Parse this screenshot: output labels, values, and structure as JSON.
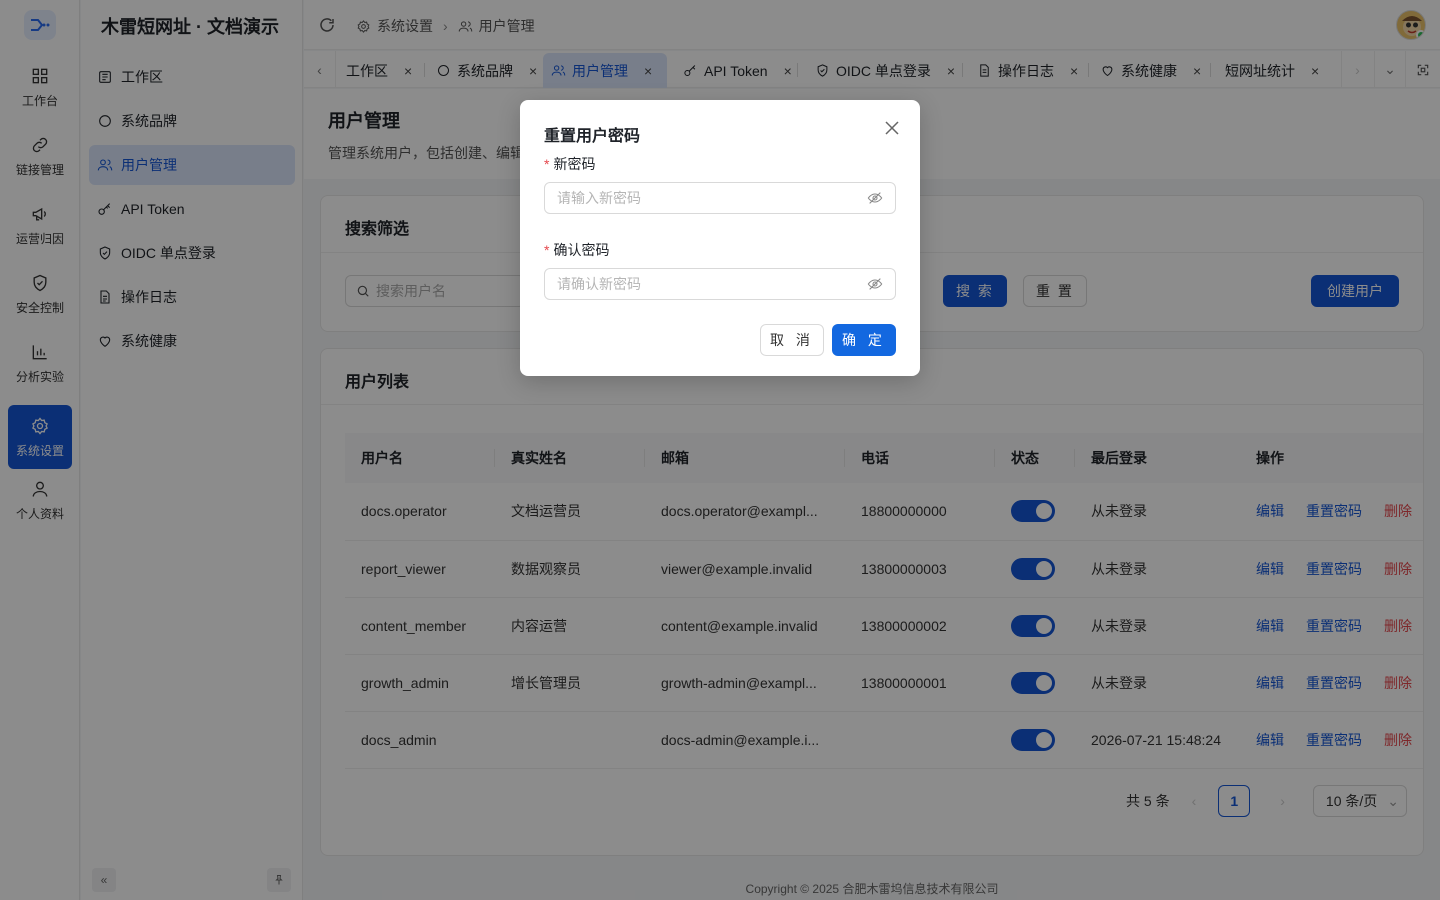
{
  "app": {
    "title": "木雷短网址 · 文档演示"
  },
  "rail": [
    {
      "label": "工作台",
      "icon": "grid-icon",
      "active": false
    },
    {
      "label": "链接管理",
      "icon": "link-icon",
      "active": false
    },
    {
      "label": "运营归因",
      "icon": "megaphone-icon",
      "active": false
    },
    {
      "label": "安全控制",
      "icon": "shield-check-icon",
      "active": false
    },
    {
      "label": "分析实验",
      "icon": "bar-chart-icon",
      "active": false
    },
    {
      "label": "系统设置",
      "icon": "gear-icon",
      "active": true
    },
    {
      "label": "个人资料",
      "icon": "user-icon",
      "active": false
    }
  ],
  "menu": [
    {
      "label": "工作区",
      "icon": "workspace-icon",
      "active": false
    },
    {
      "label": "系统品牌",
      "icon": "circle-icon",
      "active": false
    },
    {
      "label": "用户管理",
      "icon": "users-icon",
      "active": true
    },
    {
      "label": "API Token",
      "icon": "key-icon",
      "active": false
    },
    {
      "label": "OIDC 单点登录",
      "icon": "shield-icon",
      "active": false
    },
    {
      "label": "操作日志",
      "icon": "file-text-icon",
      "active": false
    },
    {
      "label": "系统健康",
      "icon": "heart-icon",
      "active": false
    }
  ],
  "breadcrumb": {
    "parent": "系统设置",
    "current": "用户管理"
  },
  "tabs": [
    {
      "label": "工作区",
      "active": false
    },
    {
      "label": "系统品牌",
      "active": false
    },
    {
      "label": "用户管理",
      "active": true
    },
    {
      "label": "API Token",
      "active": false
    },
    {
      "label": "OIDC 单点登录",
      "active": false
    },
    {
      "label": "操作日志",
      "active": false
    },
    {
      "label": "系统健康",
      "active": false
    },
    {
      "label": "短网址统计",
      "active": false
    }
  ],
  "page": {
    "title": "用户管理",
    "description": "管理系统用户，包括创建、编辑"
  },
  "search_card": {
    "title": "搜索筛选",
    "search_placeholder": "搜索用户名",
    "search_label": "搜 索",
    "reset_label": "重 置",
    "create_label": "创建用户"
  },
  "list_card": {
    "title": "用户列表",
    "columns": [
      "用户名",
      "真实姓名",
      "邮箱",
      "电话",
      "状态",
      "最后登录",
      "操作"
    ],
    "rows": [
      {
        "username": "docs.operator",
        "realname": "文档运营员",
        "email": "docs.operator@exampl...",
        "phone": "18800000000",
        "enabled": true,
        "last_login": "从未登录"
      },
      {
        "username": "report_viewer",
        "realname": "数据观察员",
        "email": "viewer@example.invalid",
        "phone": "13800000003",
        "enabled": true,
        "last_login": "从未登录"
      },
      {
        "username": "content_member",
        "realname": "内容运营",
        "email": "content@example.invalid",
        "phone": "13800000002",
        "enabled": true,
        "last_login": "从未登录"
      },
      {
        "username": "growth_admin",
        "realname": "增长管理员",
        "email": "growth-admin@exampl...",
        "phone": "13800000001",
        "enabled": true,
        "last_login": "从未登录"
      },
      {
        "username": "docs_admin",
        "realname": "",
        "email": "docs-admin@example.i...",
        "phone": "",
        "enabled": true,
        "last_login": "2026-07-21 15:48:24"
      }
    ],
    "actions": {
      "edit": "编辑",
      "reset_password": "重置密码",
      "delete": "删除"
    },
    "pagination": {
      "total": "共 5 条",
      "current_page": "1",
      "page_size": "10 条/页"
    }
  },
  "footer": "Copyright © 2025 合肥木雷坞信息技术有限公司",
  "modal": {
    "title": "重置用户密码",
    "new_password_label": "新密码",
    "new_password_placeholder": "请输入新密码",
    "confirm_password_label": "确认密码",
    "confirm_password_placeholder": "请确认新密码",
    "cancel_label": "取 消",
    "ok_label": "确 定"
  },
  "colors": {
    "primary": "#1456d6",
    "danger": "#e5484d",
    "menu_active_bg": "#dbe6fb"
  }
}
